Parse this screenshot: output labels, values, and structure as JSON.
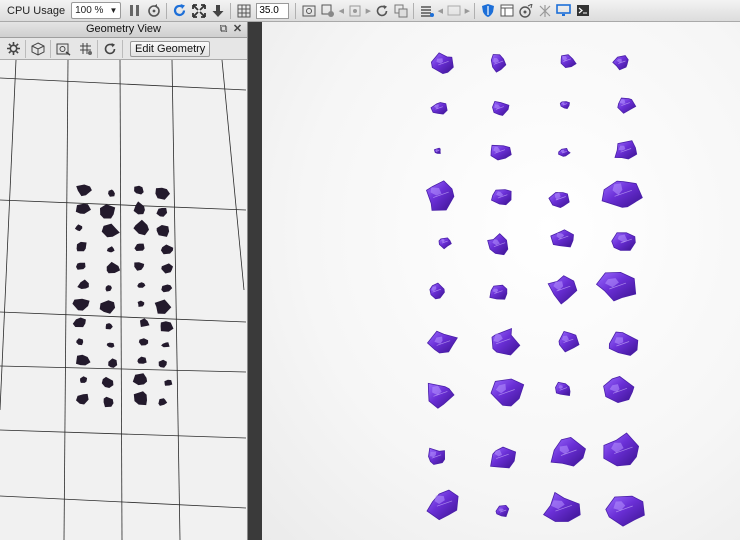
{
  "toolbar": {
    "monitor_label": "CPU Usage",
    "zoom_value": "100 %",
    "frame_value": "35.0"
  },
  "panel": {
    "title": "Geometry View",
    "edit_button_label": "Edit Geometry"
  },
  "colors": {
    "gem_fill": "#6a2fd6",
    "gem_shadow": "#3c1391",
    "gem_highlight": "#b694ff",
    "silhouette": "#231a2c",
    "grid_line": "#2b2b2b",
    "accent_blue": "#1d6fd8"
  },
  "icons": [
    "pause-icon",
    "sync-icon",
    "refresh-icon",
    "expand-icon",
    "download-icon",
    "grid-icon",
    "render-icon",
    "shield-icon",
    "panel-icon",
    "settings-icon",
    "console-icon"
  ]
}
